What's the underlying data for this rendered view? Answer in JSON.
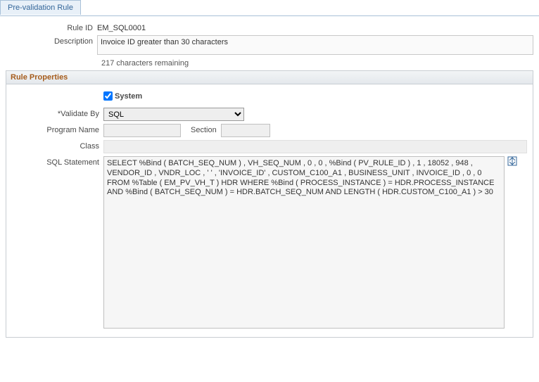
{
  "tab": {
    "label": "Pre-validation Rule"
  },
  "labels": {
    "ruleId": "Rule ID",
    "description": "Description",
    "validateBy": "*Validate By",
    "programName": "Program Name",
    "section": "Section",
    "class": "Class",
    "sqlStatement": "SQL Statement",
    "system": "System"
  },
  "fields": {
    "ruleId": "EM_SQL0001",
    "description": "Invoice ID greater than 30 characters",
    "remaining": "217 characters remaining",
    "systemChecked": true,
    "validateBy": "SQL",
    "validateByOptions": [
      "SQL"
    ],
    "programName": "",
    "section": "",
    "class": "",
    "sqlStatement": "SELECT %Bind ( BATCH_SEQ_NUM ) , VH_SEQ_NUM , 0 , 0 , %Bind ( PV_RULE_ID ) , 1 , 18052 , 948 , VENDOR_ID , VNDR_LOC , ' ' , 'INVOICE_ID' , CUSTOM_C100_A1 , BUSINESS_UNIT , INVOICE_ID , 0 , 0 FROM %Table ( EM_PV_VH_T ) HDR WHERE %Bind ( PROCESS_INSTANCE ) = HDR.PROCESS_INSTANCE AND %Bind ( BATCH_SEQ_NUM ) = HDR.BATCH_SEQ_NUM AND LENGTH ( HDR.CUSTOM_C100_A1 ) > 30"
  },
  "section": {
    "title": "Rule Properties"
  }
}
